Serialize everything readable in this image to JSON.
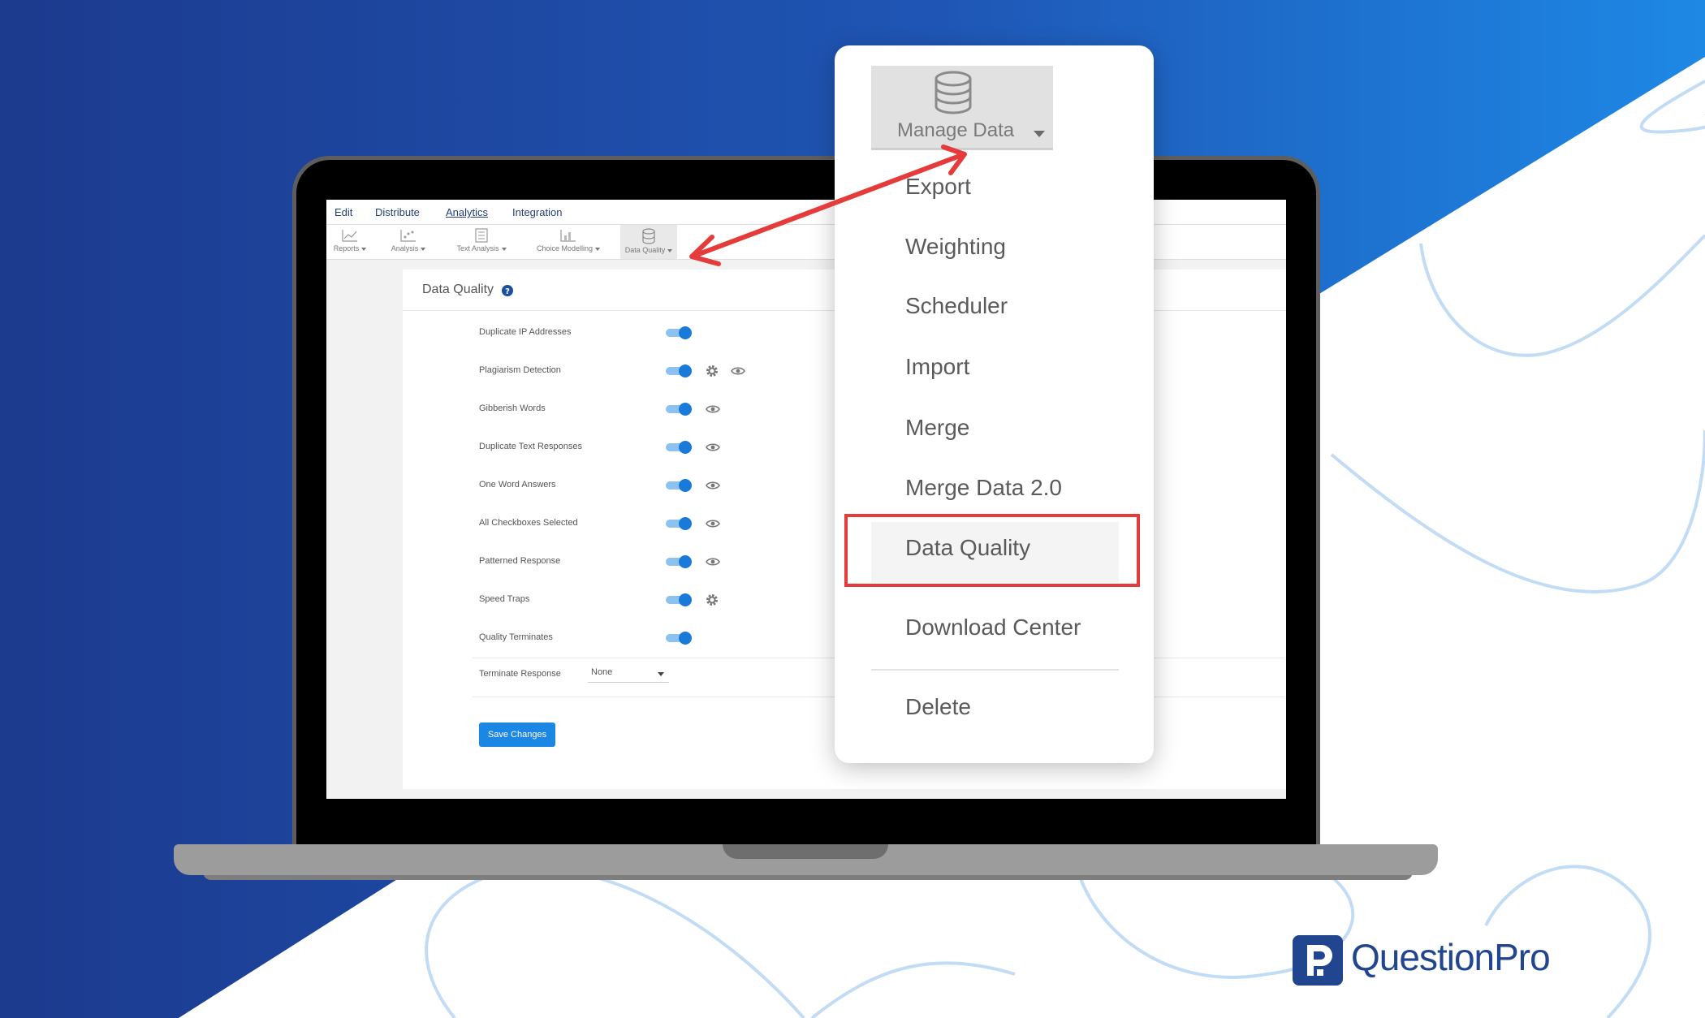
{
  "app": {
    "menu": [
      "Edit",
      "Distribute",
      "Analytics",
      "Integration"
    ],
    "active_menu": "Analytics",
    "toolbar": [
      {
        "label": "Reports",
        "icon": "line-chart-icon"
      },
      {
        "label": "Analysis",
        "icon": "scatter-chart-icon"
      },
      {
        "label": "Text Analysis",
        "icon": "document-grid-icon"
      },
      {
        "label": "Choice Modelling",
        "icon": "choice-chart-icon"
      },
      {
        "label": "Data Quality",
        "icon": "database-icon",
        "selected": true
      }
    ]
  },
  "panel": {
    "title": "Data Quality",
    "rows": [
      {
        "label": "Duplicate IP Addresses",
        "enabled": true,
        "icons": []
      },
      {
        "label": "Plagiarism Detection",
        "enabled": true,
        "icons": [
          "gear-icon",
          "eye-icon"
        ]
      },
      {
        "label": "Gibberish Words",
        "enabled": true,
        "icons": [
          "eye-icon"
        ]
      },
      {
        "label": "Duplicate Text Responses",
        "enabled": true,
        "icons": [
          "eye-icon"
        ]
      },
      {
        "label": "One Word Answers",
        "enabled": true,
        "icons": [
          "eye-icon"
        ]
      },
      {
        "label": "All Checkboxes Selected",
        "enabled": true,
        "icons": [
          "eye-icon"
        ]
      },
      {
        "label": "Patterned Response",
        "enabled": true,
        "icons": [
          "eye-icon"
        ]
      },
      {
        "label": "Speed Traps",
        "enabled": true,
        "icons": [
          "gear-icon"
        ]
      },
      {
        "label": "Quality Terminates",
        "enabled": true,
        "icons": []
      }
    ],
    "terminate": {
      "label": "Terminate Response",
      "value": "None"
    },
    "save_label": "Save Changes"
  },
  "dropdown": {
    "header": "Manage Data",
    "items": [
      "Export",
      "Weighting",
      "Scheduler",
      "Import",
      "Merge",
      "Merge Data 2.0",
      "Data Quality",
      "Download Center",
      "Delete"
    ],
    "highlighted": "Data Quality"
  },
  "brand": {
    "name": "QuestionPro"
  },
  "colors": {
    "background_dark": "#1b3f94",
    "background_light": "#1e88e5",
    "accent_blue": "#1b86e3",
    "highlight_red": "#e53b3b",
    "brand_navy": "#21458f"
  }
}
